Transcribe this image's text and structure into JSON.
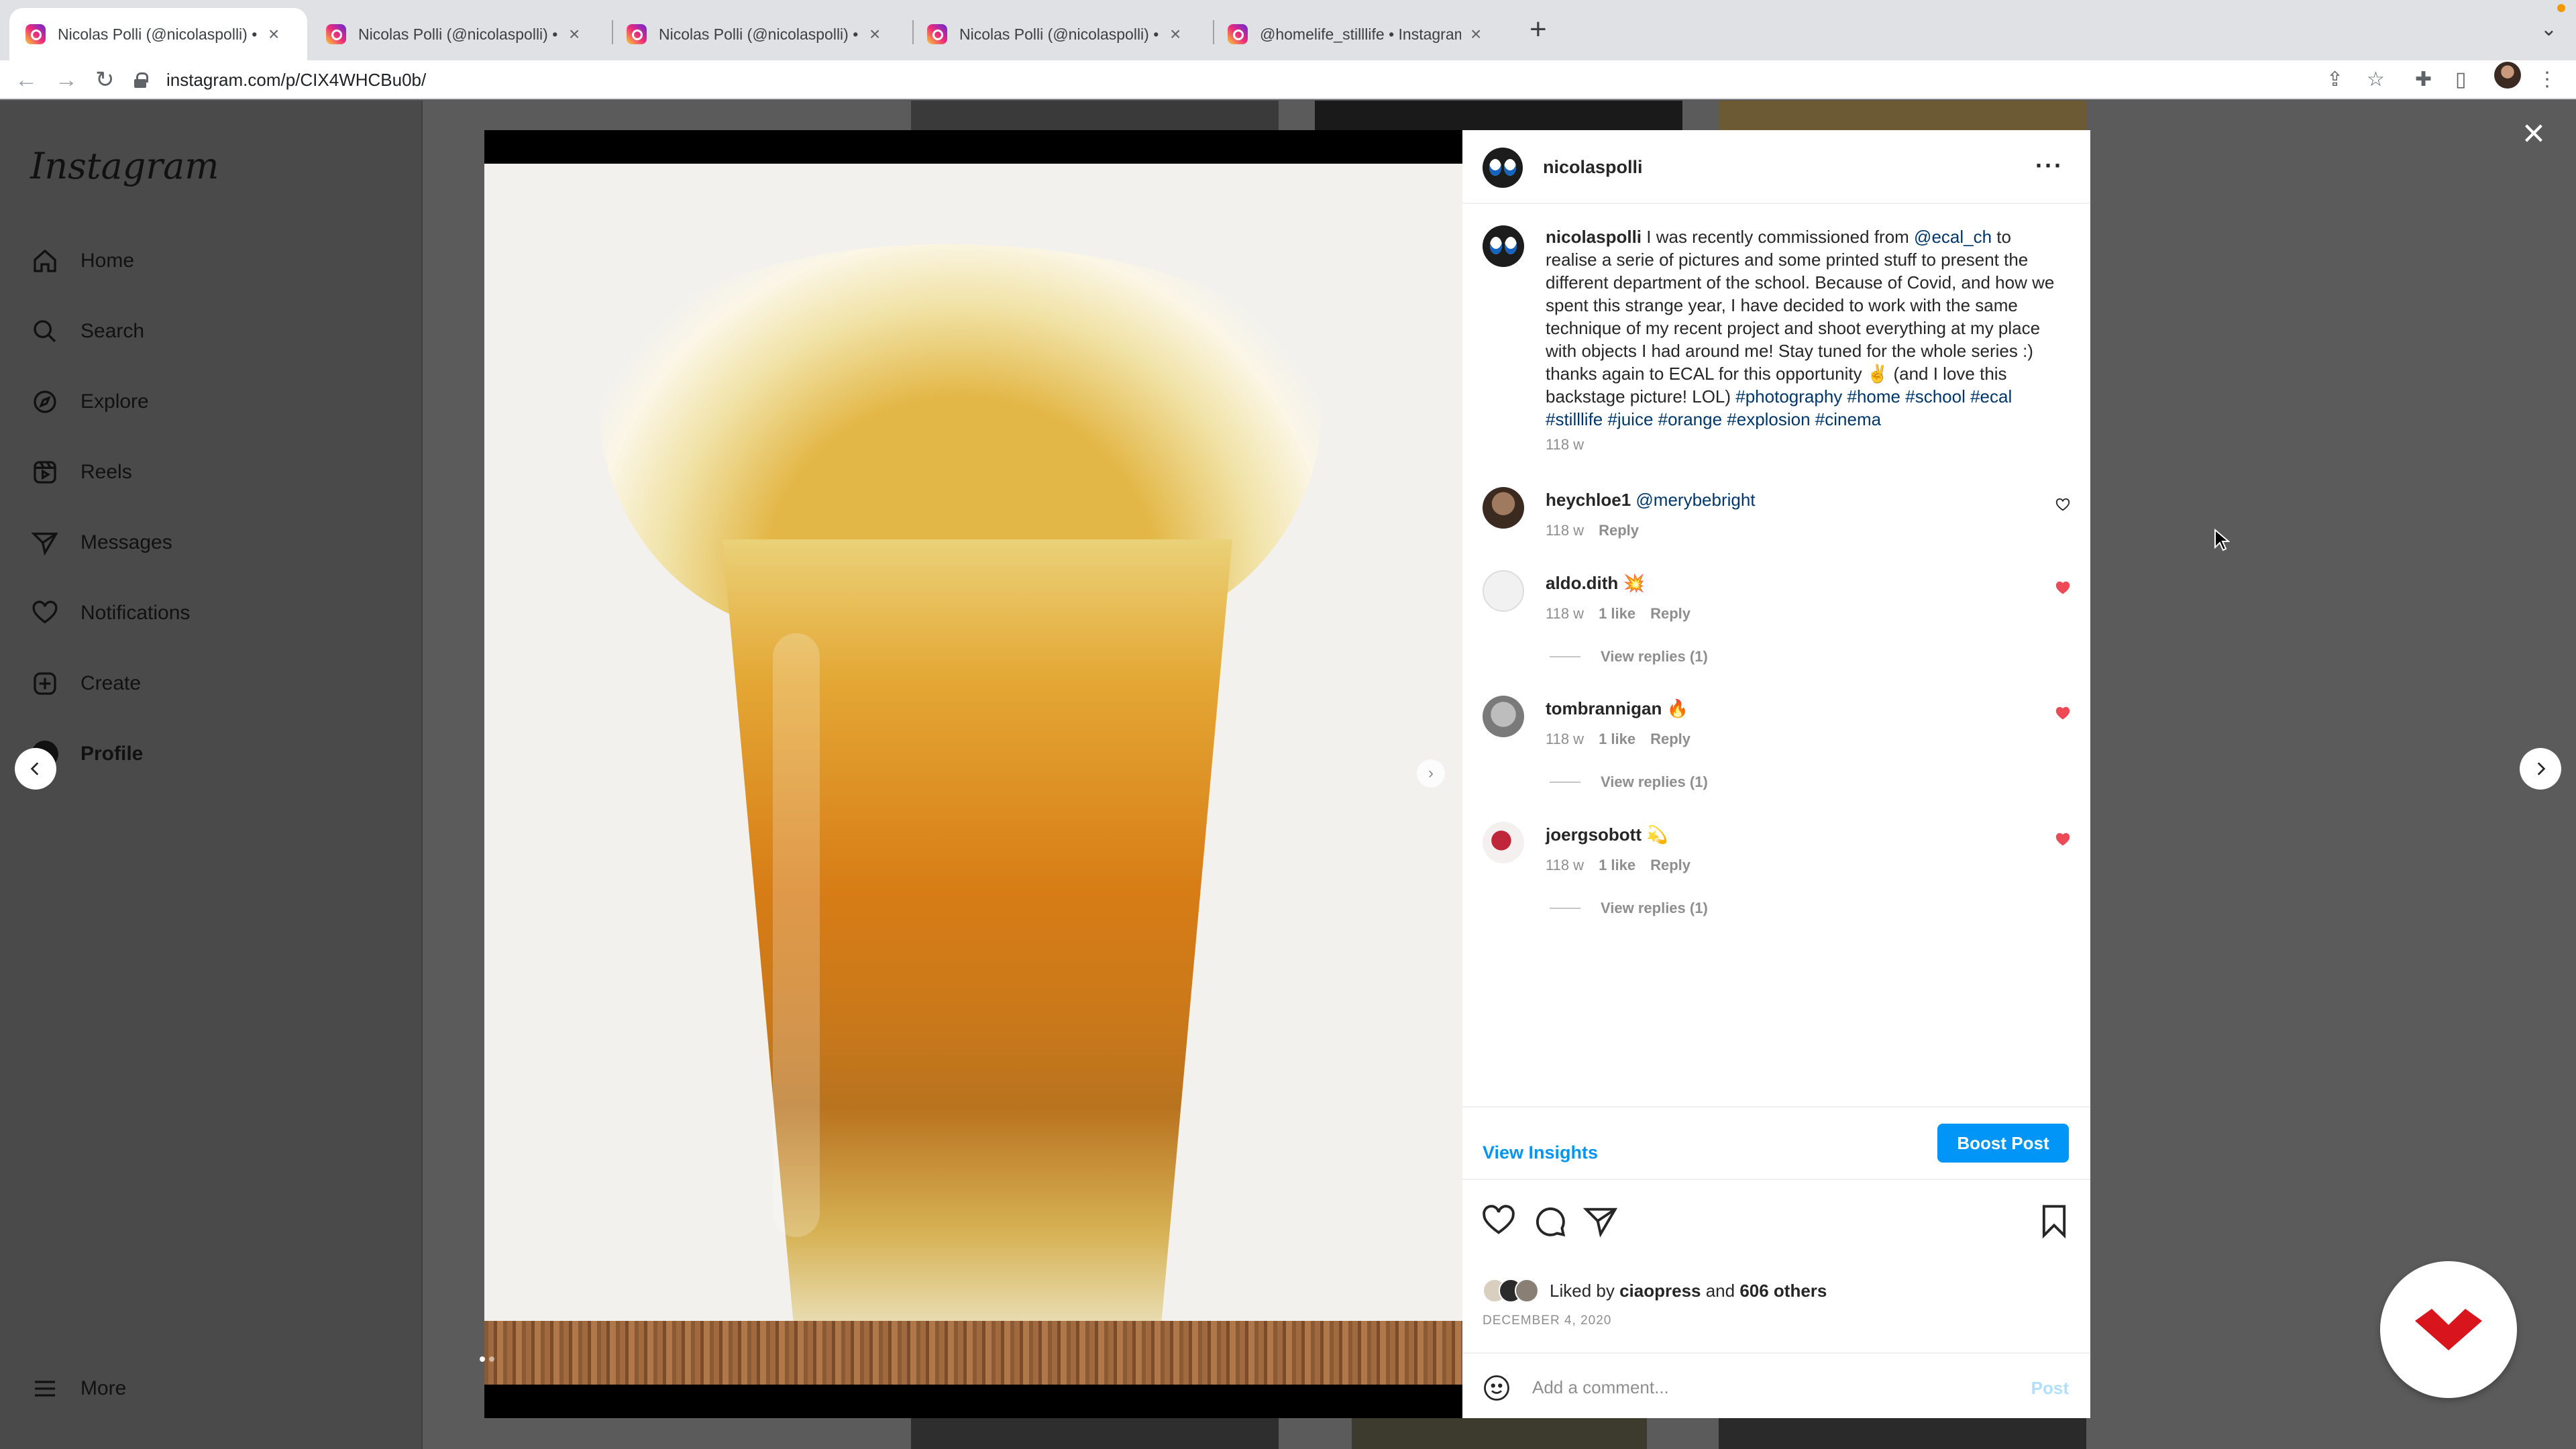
{
  "browser": {
    "tabs": [
      {
        "title": "Nicolas Polli (@nicolaspolli) • I",
        "active": true
      },
      {
        "title": "Nicolas Polli (@nicolaspolli) • I",
        "active": false
      },
      {
        "title": "Nicolas Polli (@nicolaspolli) • I",
        "active": false
      },
      {
        "title": "Nicolas Polli (@nicolaspolli) • I",
        "active": false
      },
      {
        "title": "@homelife_stilllife • Instagram",
        "active": false
      }
    ],
    "url": "instagram.com/p/CIX4WHCBu0b/"
  },
  "sidebar": {
    "logo": "Instagram",
    "items": [
      {
        "label": "Home",
        "icon": "home-icon"
      },
      {
        "label": "Search",
        "icon": "search-icon"
      },
      {
        "label": "Explore",
        "icon": "compass-icon"
      },
      {
        "label": "Reels",
        "icon": "reels-icon"
      },
      {
        "label": "Messages",
        "icon": "messages-icon"
      },
      {
        "label": "Notifications",
        "icon": "heart-icon"
      },
      {
        "label": "Create",
        "icon": "plus-square-icon"
      },
      {
        "label": "Profile",
        "icon": "avatar"
      }
    ],
    "more": "More"
  },
  "post": {
    "username": "nicolaspolli",
    "caption": {
      "user": "nicolaspolli",
      "text_before": " I was recently commissioned from ",
      "mention": "@ecal_ch",
      "text_after": " to realise a serie of pictures and some printed stuff to present the different department of the school. Because of Covid, and how we spent this strange year, I have decided to work with the same technique of my recent project and shoot everything at my place with objects I had around me! Stay tuned for the whole series :) thanks again to ECAL for this opportunity ✌️ (and I love this backstage picture! LOL) ",
      "hashtags": "#photography #home #school #ecal #stilllife #juice #orange #explosion #cinema",
      "time": "118 w"
    },
    "comments": [
      {
        "user": "heychloe1",
        "text": "@merybebright",
        "time": "118 w",
        "likes": "",
        "reply": "Reply",
        "liked": false,
        "view_replies": ""
      },
      {
        "user": "aldo.dith",
        "text": "💥",
        "time": "118 w",
        "likes": "1 like",
        "reply": "Reply",
        "liked": true,
        "view_replies": "View replies (1)"
      },
      {
        "user": "tombrannigan",
        "text": "🔥",
        "time": "118 w",
        "likes": "1 like",
        "reply": "Reply",
        "liked": true,
        "view_replies": "View replies (1)"
      },
      {
        "user": "joergsobott",
        "text": "💫",
        "time": "118 w",
        "likes": "1 like",
        "reply": "Reply",
        "liked": true,
        "view_replies": "View replies (1)"
      }
    ],
    "view_insights": "View Insights",
    "boost": "Boost Post",
    "liked_by_prefix": "Liked by ",
    "liked_by_user": "ciaopress",
    "liked_by_mid": " and ",
    "liked_by_others": "606 others",
    "date": "DECEMBER 4, 2020",
    "comment_placeholder": "Add a comment...",
    "post_button": "Post"
  },
  "colors": {
    "accent": "#0095f6",
    "like_red": "#ed4956"
  }
}
